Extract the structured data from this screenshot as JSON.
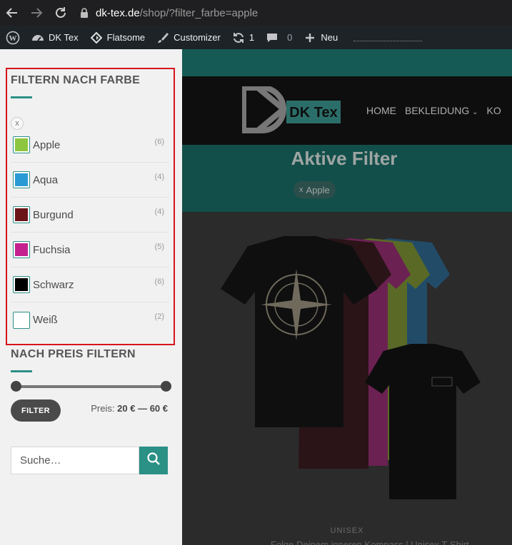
{
  "browser": {
    "url_domain": "dk-tex.de",
    "url_path": "/shop/?filter_farbe=apple"
  },
  "adminbar": {
    "site_name": "DK Tex",
    "theme": "Flatsome",
    "customizer": "Customizer",
    "updates_count": "1",
    "comments_count": "0",
    "new_label": "Neu"
  },
  "sidebar": {
    "color_filter": {
      "title": "FILTERN NACH FARBE",
      "clear_label": "x",
      "items": [
        {
          "label": "Apple",
          "count": "(6)",
          "color": "#8dc63f"
        },
        {
          "label": "Aqua",
          "count": "(4)",
          "color": "#2a9ad5"
        },
        {
          "label": "Burgund",
          "count": "(4)",
          "color": "#6b1418"
        },
        {
          "label": "Fuchsia",
          "count": "(5)",
          "color": "#c4218f"
        },
        {
          "label": "Schwarz",
          "count": "(6)",
          "color": "#000000"
        },
        {
          "label": "Weiß",
          "count": "(2)",
          "color": "#ffffff"
        }
      ]
    },
    "price_filter": {
      "title": "NACH PREIS FILTERN",
      "button": "FILTER",
      "price_prefix": "Preis:",
      "min": "20 €",
      "separator": "—",
      "max": "60 €"
    },
    "search": {
      "placeholder": "Suche…"
    }
  },
  "main": {
    "nav_items": [
      "HOME",
      "BEKLEIDUNG",
      "KO"
    ],
    "logo_text": "DK Tex",
    "hero_title": "Aktive Filter",
    "active_chip": "Apple",
    "active_chip_x": "x",
    "product_category": "UNISEX",
    "product_title": "Folge Deinem inneren Kompass | Unisex T-Shirt"
  },
  "colors": {
    "accent": "#2b9086",
    "highlight_border": "#d7141c"
  }
}
